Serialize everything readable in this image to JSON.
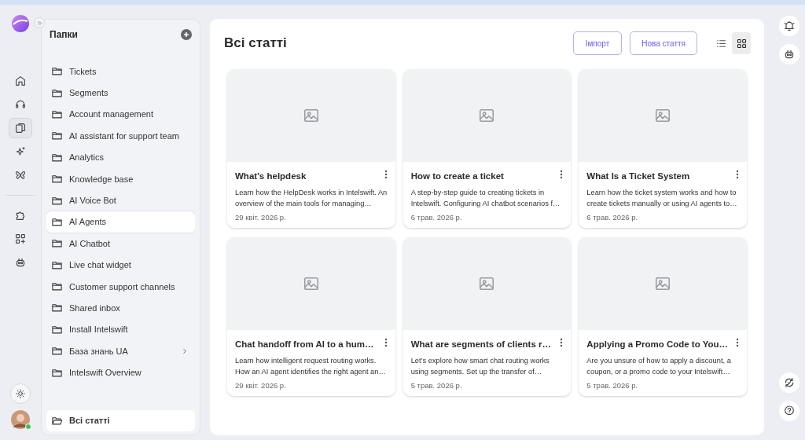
{
  "rail": {
    "nav": [
      {
        "kind": "home",
        "selected": false
      },
      {
        "kind": "headset",
        "selected": false
      },
      {
        "kind": "docs",
        "selected": true
      },
      {
        "kind": "sparkles",
        "selected": false
      },
      {
        "kind": "butterfly",
        "selected": false
      }
    ],
    "tools": [
      {
        "kind": "puzzle"
      },
      {
        "kind": "apps"
      },
      {
        "kind": "bot"
      }
    ],
    "user": {
      "online": true
    }
  },
  "folders": {
    "title": "Папки",
    "items": [
      {
        "label": "Tickets",
        "selected": false,
        "hovered": false,
        "expandable": false
      },
      {
        "label": "Segments",
        "selected": false,
        "hovered": false,
        "expandable": false
      },
      {
        "label": "Account management",
        "selected": false,
        "hovered": false,
        "expandable": false
      },
      {
        "label": "AI assistant for support team",
        "selected": false,
        "hovered": false,
        "expandable": false
      },
      {
        "label": "Analytics",
        "selected": false,
        "hovered": false,
        "expandable": false
      },
      {
        "label": "Knowledge base",
        "selected": false,
        "hovered": false,
        "expandable": false
      },
      {
        "label": "AI Voice Bot",
        "selected": false,
        "hovered": false,
        "expandable": false
      },
      {
        "label": "AI Agents",
        "selected": false,
        "hovered": true,
        "expandable": false
      },
      {
        "label": "AI Chatbot",
        "selected": false,
        "hovered": false,
        "expandable": false
      },
      {
        "label": "Live chat widget",
        "selected": false,
        "hovered": false,
        "expandable": false
      },
      {
        "label": "Customer support channels",
        "selected": false,
        "hovered": false,
        "expandable": false
      },
      {
        "label": "Shared inbox",
        "selected": false,
        "hovered": false,
        "expandable": false
      },
      {
        "label": "Install Intelswift",
        "selected": false,
        "hovered": false,
        "expandable": false
      },
      {
        "label": "База знань UA",
        "selected": false,
        "hovered": false,
        "expandable": true
      },
      {
        "label": "Intelswift Overview",
        "selected": false,
        "hovered": false,
        "expandable": false
      }
    ],
    "all": {
      "label": "Всі статті",
      "selected": true
    }
  },
  "main": {
    "title": "Всі статті",
    "buttons": [
      "Імпорт",
      "Нова стаття"
    ],
    "view_toggle": [
      {
        "kind": "list",
        "selected": false
      },
      {
        "kind": "grid",
        "selected": true
      }
    ],
    "articles": [
      {
        "title": "What’s helpdesk",
        "description": "Learn how the HelpDesk works in Intelswift. An overview of the main tools for managing…",
        "date": "29 квіт. 2026 р."
      },
      {
        "title": "How to create a ticket",
        "description": "A step-by-step guide to creating tickets in Intelswift. Configuring AI chatbot scenarios f…",
        "date": "6 трав. 2026 р."
      },
      {
        "title": "What Is a Ticket System",
        "description": "Learn how the ticket system works and how to create tickets manually or using AI agents to…",
        "date": "6 трав. 2026 р."
      },
      {
        "title": "Chat handoff from AI to a hum…",
        "description": "Learn how intelligent request routing works. How an AI agent identifies the right agent an…",
        "date": "29 квіт. 2026 р."
      },
      {
        "title": "What are segments of clients r…",
        "description": "Let’s explore how smart chat routing works using segments. Set up the transfer of…",
        "date": "5 трав. 2026 р."
      },
      {
        "title": "Applying a Promo Code to You…",
        "description": "Are you unsure of how to apply a discount, a coupon, or a promo code to your Intelswift…",
        "date": "5 трав. 2026 р."
      }
    ]
  },
  "right_rail": {
    "top": [
      {
        "kind": "bell"
      },
      {
        "kind": "bot"
      }
    ],
    "bottom": [
      {
        "kind": "sync"
      },
      {
        "kind": "help"
      }
    ]
  }
}
